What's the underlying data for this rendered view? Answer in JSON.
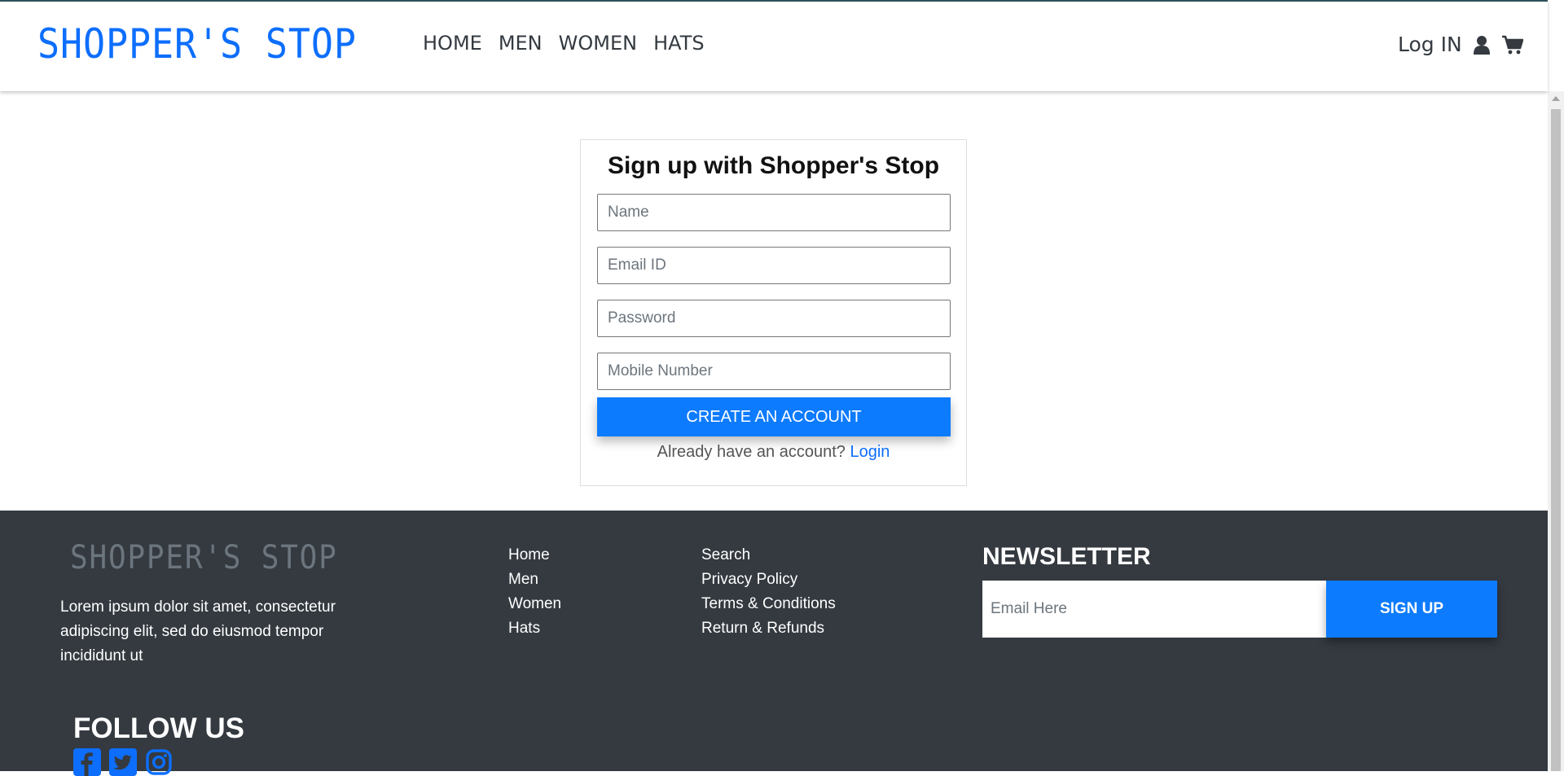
{
  "header": {
    "brand": "SHOPPER'S STOP",
    "nav": [
      "HOME",
      "MEN",
      "WOMEN",
      "HATS"
    ],
    "login": "Log IN",
    "icons": [
      "user-icon",
      "cart-icon"
    ]
  },
  "signup": {
    "title": "Sign up with Shopper's Stop",
    "fields": {
      "name_placeholder": "Name",
      "email_placeholder": "Email ID",
      "password_placeholder": "Password",
      "mobile_placeholder": "Mobile Number"
    },
    "submit": "CREATE AN ACCOUNT",
    "already_text": "Already have an account?",
    "login_link": "Login"
  },
  "footer": {
    "brand": "SHOPPER'S STOP",
    "about": "Lorem ipsum dolor sit amet, consectetur adipiscing elit, sed do eiusmod tempor incididunt ut",
    "links_col1": [
      "Home",
      "Men",
      "Women",
      "Hats"
    ],
    "links_col2": [
      "Search",
      "Privacy Policy",
      "Terms & Conditions",
      "Return & Refunds"
    ],
    "newsletter": {
      "title": "NEWSLETTER",
      "placeholder": "Email Here",
      "button": "SIGN UP"
    },
    "follow_title": "FOLLOW US",
    "social_icons": [
      "facebook-icon",
      "twitter-icon",
      "instagram-icon"
    ]
  },
  "colors": {
    "brand_blue": "#0d6efd",
    "button_blue": "#0d7bfd",
    "footer_bg": "#343a40",
    "nav_text": "#343a40"
  }
}
